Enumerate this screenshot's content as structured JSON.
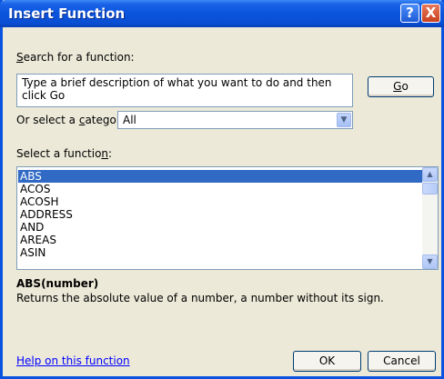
{
  "window": {
    "title": "Insert Function"
  },
  "titlebar": {
    "help_glyph": "?",
    "close_glyph": "X"
  },
  "search": {
    "label_prefix": "",
    "label_accel": "S",
    "label_rest": "earch for a function:",
    "value": "Type a brief description of what you want to do and then click Go",
    "go_accel": "G",
    "go_rest": "o"
  },
  "category": {
    "label_prefix": "Or select a ",
    "label_accel": "c",
    "label_rest": "ategory:",
    "selected": "All"
  },
  "functions": {
    "label_prefix": "Select a functio",
    "label_accel": "n",
    "label_rest": ":",
    "items": [
      "ABS",
      "ACOS",
      "ACOSH",
      "ADDRESS",
      "AND",
      "AREAS",
      "ASIN"
    ],
    "selected_index": 0
  },
  "details": {
    "signature": "ABS(number)",
    "description": "Returns the absolute value of a number, a number without its sign."
  },
  "footer": {
    "help_link": "Help on this function",
    "ok": "OK",
    "cancel": "Cancel"
  }
}
